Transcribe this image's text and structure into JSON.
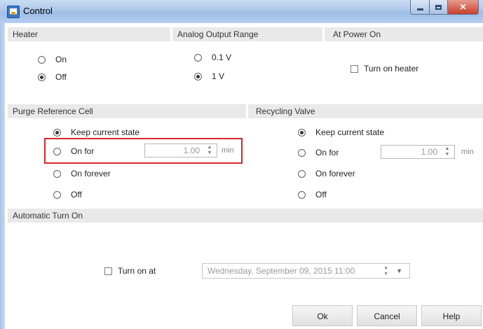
{
  "window": {
    "title": "Control"
  },
  "heater": {
    "header": "Heater",
    "options": [
      {
        "label": "On",
        "selected": false
      },
      {
        "label": "Off",
        "selected": true
      }
    ]
  },
  "analog_output": {
    "header": "Analog Output Range",
    "options": [
      {
        "label": "0.1 V",
        "selected": false
      },
      {
        "label": "1 V",
        "selected": true
      }
    ]
  },
  "power_on": {
    "header": "At Power On",
    "checkbox_label": "Turn on heater",
    "checked": false
  },
  "purge": {
    "header": "Purge Reference Cell",
    "options": [
      {
        "label": "Keep current state",
        "selected": true
      },
      {
        "label": "On for",
        "selected": false
      },
      {
        "label": "On forever",
        "selected": false
      },
      {
        "label": "Off",
        "selected": false
      }
    ],
    "duration_value": "1.00",
    "duration_unit": "min"
  },
  "recycling": {
    "header": "Recycling Valve",
    "options": [
      {
        "label": "Keep current state",
        "selected": true
      },
      {
        "label": "On for",
        "selected": false
      },
      {
        "label": "On forever",
        "selected": false
      },
      {
        "label": "Off",
        "selected": false
      }
    ],
    "duration_value": "1.00",
    "duration_unit": "min"
  },
  "auto_on": {
    "header": "Automatic Turn On",
    "checkbox_label": "Turn on at",
    "checked": false,
    "datetime_value": "Wednesday, September 09, 2015  11:00"
  },
  "buttons": {
    "ok": "Ok",
    "cancel": "Cancel",
    "help": "Help"
  },
  "colors": {
    "highlight": "#d9262a",
    "section_bg": "#e9e9e9",
    "titlebar": "#aec8ea"
  }
}
